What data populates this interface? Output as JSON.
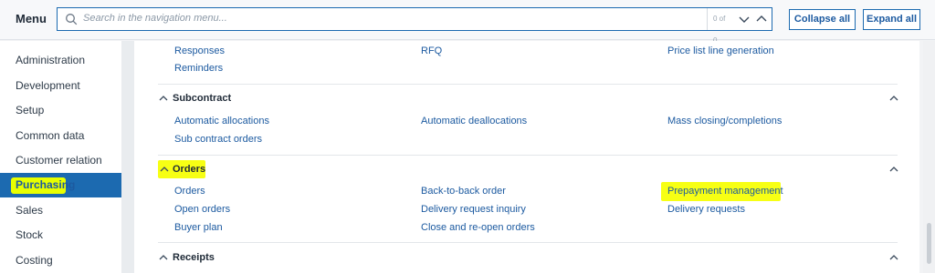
{
  "header": {
    "title": "Menu",
    "search_placeholder": "Search in the navigation menu...",
    "search_count": "0 of 0",
    "collapse_all": "Collapse all",
    "expand_all": "Expand all"
  },
  "sidebar": {
    "items": [
      {
        "label": "Administration"
      },
      {
        "label": "Development"
      },
      {
        "label": "Setup"
      },
      {
        "label": "Common data"
      },
      {
        "label": "Customer relation"
      },
      {
        "label": "Purchasing"
      },
      {
        "label": "Sales"
      },
      {
        "label": "Stock"
      },
      {
        "label": "Costing"
      }
    ]
  },
  "sections": {
    "top": {
      "links": [
        "Responses",
        "RFQ",
        "Price list line generation",
        "Reminders"
      ]
    },
    "subcontract": {
      "title": "Subcontract",
      "links": [
        "Automatic allocations",
        "Automatic deallocations",
        "Mass closing/completions",
        "Sub contract orders"
      ]
    },
    "orders": {
      "title": "Orders",
      "links": [
        "Orders",
        "Back-to-back order",
        "Prepayment management",
        "Open orders",
        "Delivery request inquiry",
        "Delivery requests",
        "Buyer plan",
        "Close and re-open orders"
      ]
    },
    "receipts": {
      "title": "Receipts"
    }
  },
  "colors": {
    "accent": "#1c6ab0",
    "link": "#1c5aa0",
    "highlight": "#f7ff14"
  }
}
